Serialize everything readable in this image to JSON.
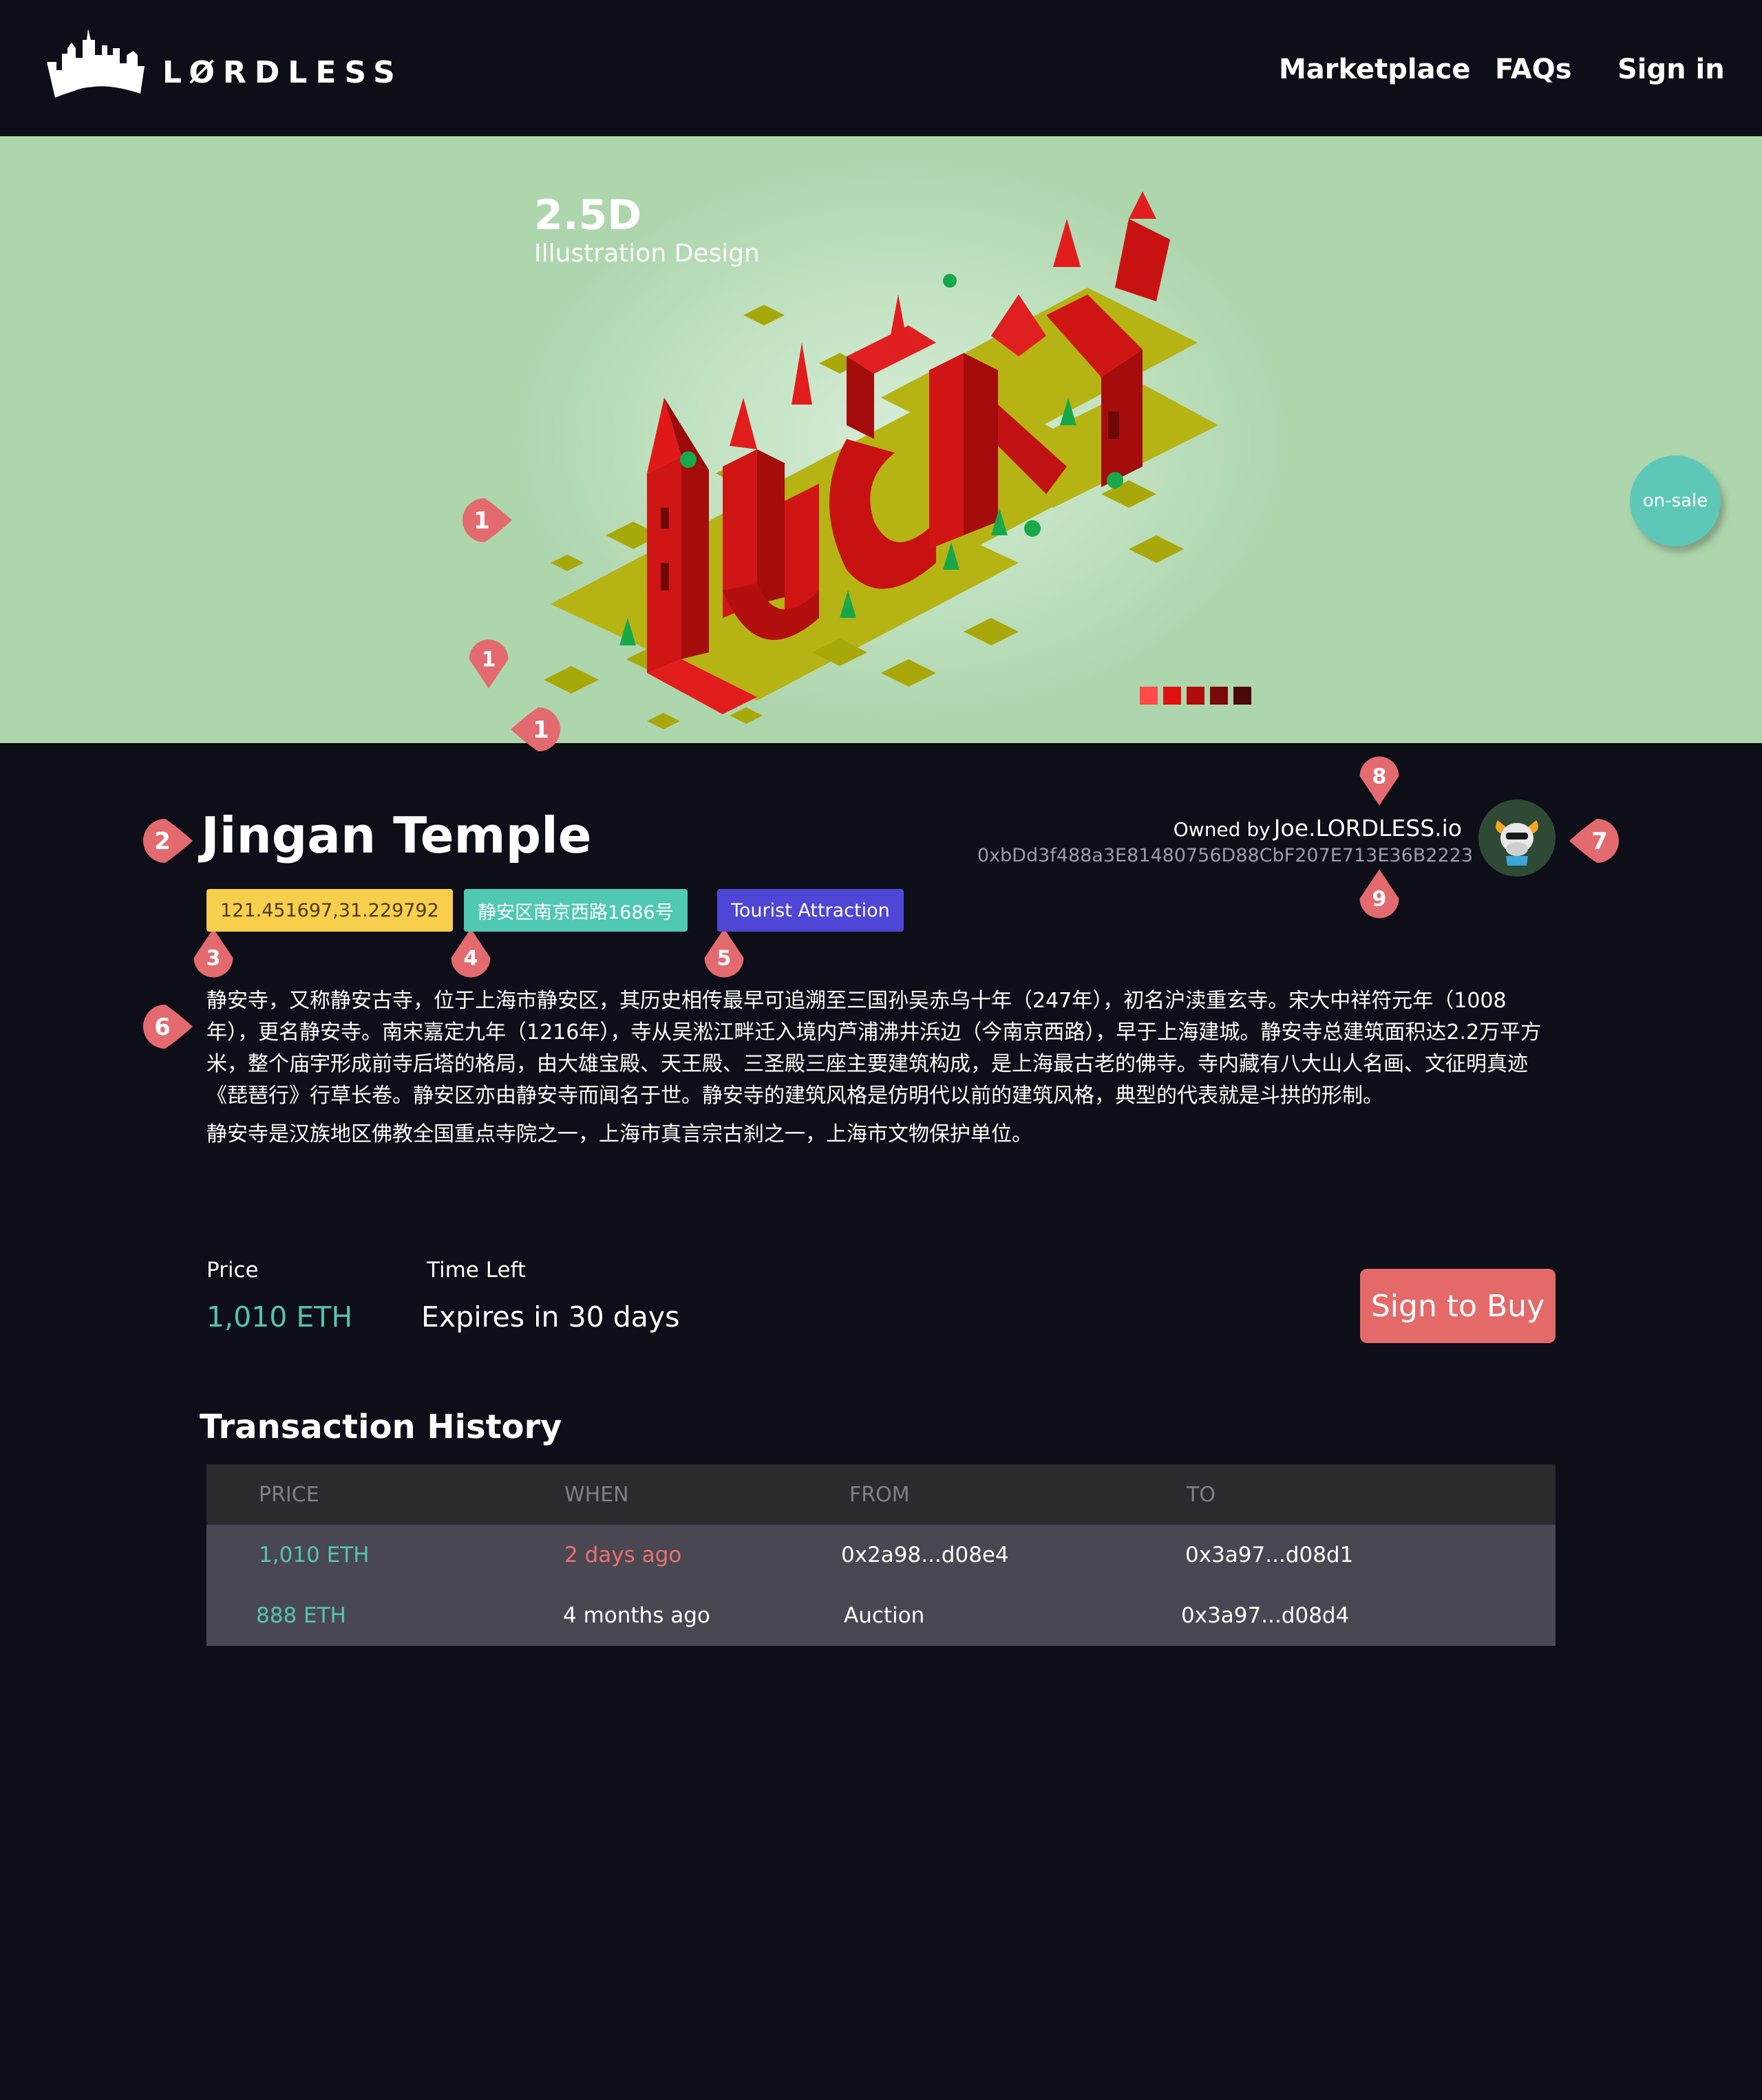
{
  "header": {
    "logo_text": "LØRDLESS",
    "nav": [
      "Marketplace",
      "FAQs",
      "Sign in"
    ]
  },
  "hero": {
    "title": "2.5D",
    "subtitle": "Illustration Design",
    "badge": "on-sale",
    "dots": [
      "#ff4a4a",
      "#e01010",
      "#b00c0c",
      "#7a0a0a",
      "#4a0808"
    ]
  },
  "markers": [
    "1",
    "1",
    "1",
    "2",
    "3",
    "4",
    "5",
    "6",
    "7",
    "8",
    "9"
  ],
  "detail": {
    "title": "Jingan Temple",
    "tags": {
      "coordinates": "121.451697,31.229792",
      "address": "静安区南京西路1686号",
      "category": "Tourist Attraction"
    },
    "owner_prefix": "Owned by",
    "owner_name": "Joe.LORDLESS.io",
    "owner_address": "0xbDd3f488a3E81480756D88CbF207E713E36B2223",
    "description": [
      "静安寺，又称静安古寺，位于上海市静安区，其历史相传最早可追溯至三国孙吴赤乌十年（247年），初名沪渎重玄寺。宋大中祥符元年（1008年），更名静安寺。南宋嘉定九年（1216年），寺从吴淞江畔迁入境内芦浦沸井浜边（今南京西路），早于上海建城。静安寺总建筑面积达2.2万平方米，整个庙宇形成前寺后塔的格局，由大雄宝殿、天王殿、三圣殿三座主要建筑构成，是上海最古老的佛寺。寺内藏有八大山人名画、文征明真迹《琵琶行》行草长卷。静安区亦由静安寺而闻名于世。静安寺的建筑风格是仿明代以前的建筑风格，典型的代表就是斗拱的形制。",
      "静安寺是汉族地区佛教全国重点寺院之一，上海市真言宗古刹之一，上海市文物保护单位。"
    ]
  },
  "sale": {
    "price_label": "Price",
    "price_value": "1,010 ETH",
    "time_label": "Time Left",
    "time_value": "Expires in 30 days",
    "buy_label": "Sign to Buy"
  },
  "transactions": {
    "title": "Transaction History",
    "headers": [
      "PRICE",
      "WHEN",
      "FROM",
      "TO"
    ],
    "rows": [
      {
        "price": "1,010 ETH",
        "when": "2 days ago",
        "from": "0x2a98...d08e4",
        "to": "0x3a97...d08d1"
      },
      {
        "price": "888 ETH",
        "when": "4 months ago",
        "from": "Auction",
        "to": "0x3a97...d08d4"
      }
    ]
  },
  "colors": {
    "background": "#0d0e17",
    "accent_teal": "#55c3b0",
    "accent_red": "#e46a6a",
    "marker": "#e36a6e",
    "hero_bg": "#aed6ad"
  }
}
